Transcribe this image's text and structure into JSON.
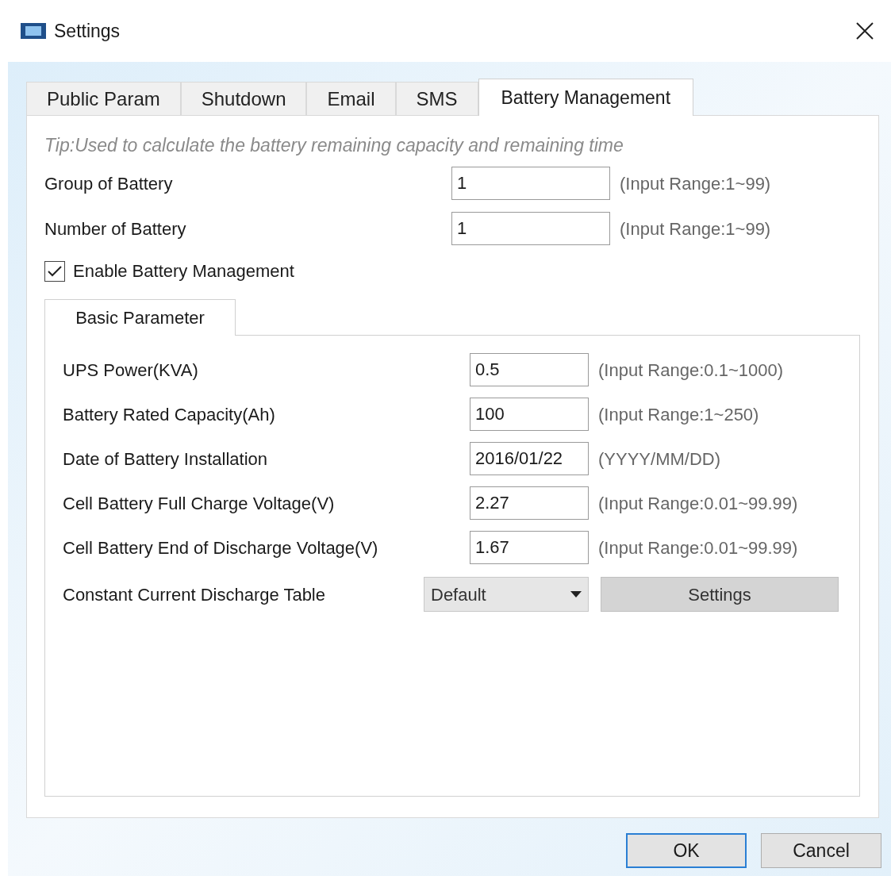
{
  "window": {
    "title": "Settings"
  },
  "tabs": [
    {
      "label": "Public Param",
      "selected": false
    },
    {
      "label": "Shutdown",
      "selected": false
    },
    {
      "label": "Email",
      "selected": false
    },
    {
      "label": "SMS",
      "selected": false
    },
    {
      "label": "Battery Management",
      "selected": true
    }
  ],
  "tip": "Tip:Used to calculate the battery remaining capacity and remaining time",
  "fields": [
    {
      "label": "Group of Battery",
      "value": "1",
      "hint": "(Input Range:1~99)"
    },
    {
      "label": "Number of Battery",
      "value": "1",
      "hint": "(Input Range:1~99)"
    }
  ],
  "enable_checkbox": {
    "label": "Enable Battery Management",
    "checked": true
  },
  "inner_tabs": [
    {
      "label": "Basic Parameter",
      "selected": true
    }
  ],
  "parameters": [
    {
      "kind": "input",
      "label": "UPS Power(KVA)",
      "value": "0.5",
      "hint": "(Input Range:0.1~1000)"
    },
    {
      "kind": "input",
      "label": "Battery Rated Capacity(Ah)",
      "value": "100",
      "hint": "(Input Range:1~250)"
    },
    {
      "kind": "input",
      "label": "Date of Battery Installation",
      "value": "2016/01/22",
      "hint": "(YYYY/MM/DD)"
    },
    {
      "kind": "input",
      "label": "Cell Battery Full Charge Voltage(V)",
      "value": "2.27",
      "hint": "(Input Range:0.01~99.99)"
    },
    {
      "kind": "input",
      "label": "Cell Battery End of Discharge Voltage(V)",
      "value": "1.67",
      "hint": "(Input Range:0.01~99.99)"
    },
    {
      "kind": "dropdown",
      "label": "Constant Current Discharge Table",
      "value": "Default",
      "button": "Settings"
    }
  ],
  "buttons": [
    {
      "label": "OK",
      "default": true
    },
    {
      "label": "Cancel",
      "default": false
    }
  ]
}
